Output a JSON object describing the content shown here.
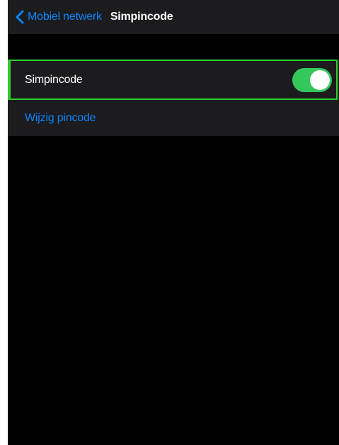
{
  "nav": {
    "back_label": "Mobiel netwerk",
    "title": "Simpincode",
    "back_icon": "chevron-left-icon"
  },
  "settings": {
    "toggle_row": {
      "label": "Simpincode",
      "enabled": true
    },
    "link_row": {
      "label": "Wijzig pincode"
    }
  },
  "colors": {
    "accent_blue": "#0a84ff",
    "toggle_on": "#34c759",
    "focus_outline": "#2ecc2e",
    "background": "#000000",
    "cell_background": "#1c1c1e"
  }
}
